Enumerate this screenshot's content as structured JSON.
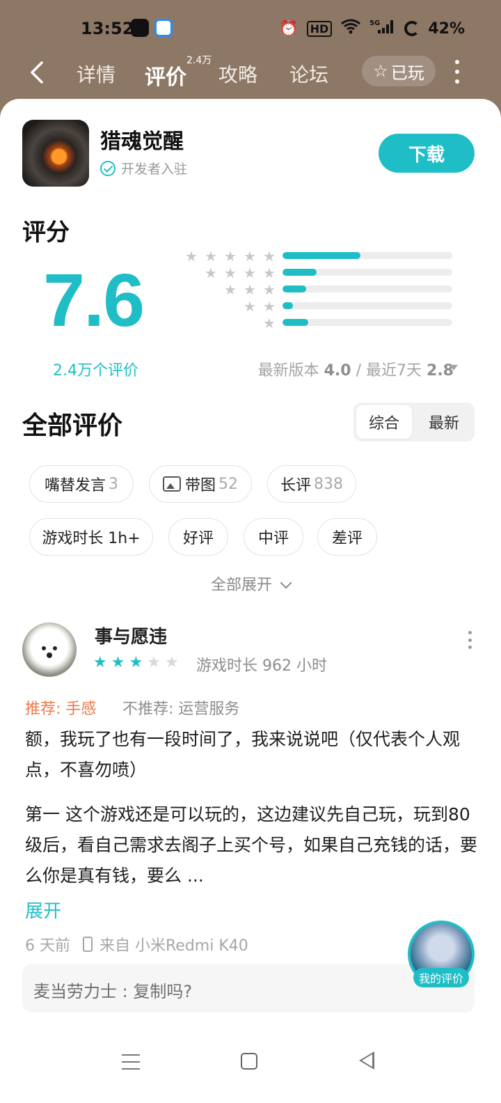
{
  "status_bar": {
    "time": "13:52",
    "battery": "42%",
    "network": "5G",
    "hd_label": "HD",
    "icons": [
      "alarm-icon",
      "hd-icon",
      "wifi-icon",
      "5g-signal-icon",
      "battery-icon"
    ]
  },
  "nav": {
    "tabs": [
      {
        "label": "详情",
        "active": false
      },
      {
        "label": "评价",
        "active": true,
        "badge": "2.4万"
      },
      {
        "label": "攻略",
        "active": false
      },
      {
        "label": "论坛",
        "active": false
      }
    ],
    "played_label": "已玩"
  },
  "app": {
    "name": "猎魂觉醒",
    "verified_label": "开发者入驻",
    "download_label": "下载"
  },
  "rating": {
    "title": "评分",
    "score": "7.6",
    "count_label": "2.4万个评价",
    "distribution": [
      {
        "stars": 5,
        "fraction": 0.46
      },
      {
        "stars": 4,
        "fraction": 0.2
      },
      {
        "stars": 3,
        "fraction": 0.14
      },
      {
        "stars": 2,
        "fraction": 0.06
      },
      {
        "stars": 1,
        "fraction": 0.15
      }
    ],
    "version_label": "最新版本",
    "version_score": "4.0",
    "separator": "/",
    "recent_label": "最近7天",
    "recent_score": "2.8"
  },
  "reviews_section": {
    "title": "全部评价",
    "sort_options": [
      "综合",
      "最新"
    ],
    "filters": [
      {
        "label": "嘴替发言",
        "count": "3"
      },
      {
        "label": "带图",
        "count": "52",
        "icon": "image-icon"
      },
      {
        "label": "长评",
        "count": "838"
      },
      {
        "label": "游戏时长 1h+",
        "count": ""
      },
      {
        "label": "好评",
        "count": ""
      },
      {
        "label": "中评",
        "count": ""
      },
      {
        "label": "差评",
        "count": ""
      }
    ],
    "expand_all_label": "全部展开"
  },
  "review": {
    "user": "事与愿违",
    "stars": 3,
    "play_time": "游戏时长 962 小时",
    "recommend": "推荐: 手感",
    "not_recommend": "不推荐: 运营服务",
    "paragraph1": "额，我玩了也有一段时间了，我来说说吧（仅代表个人观点，不喜勿喷）",
    "paragraph2": "第一 这个游戏还是可以玩的，这边建议先自己玩，玩到80级后，看自己需求去阁子上买个号，如果自己充钱的话，要么你是真有钱，要么 ...",
    "expand_label": "展开",
    "time_ago": "6 天前",
    "device": "来自 小米Redmi K40",
    "reply_user": "麦当劳力士",
    "reply_text": "复制吗?"
  },
  "my_review_label": "我的评价",
  "colors": {
    "accent": "#1fbec6",
    "header_bg": "#8d7866",
    "recommend": "#ec7a4c"
  }
}
